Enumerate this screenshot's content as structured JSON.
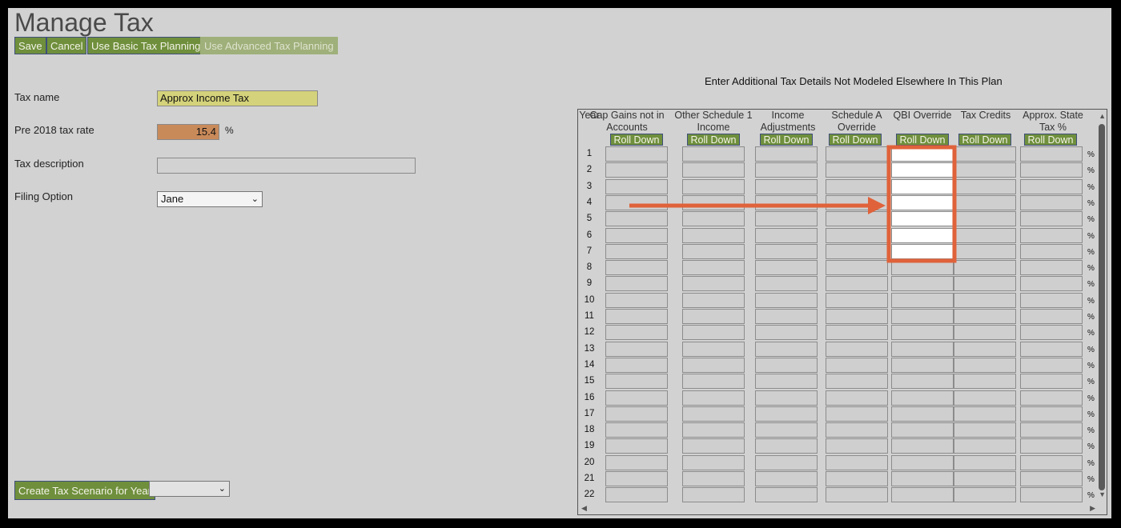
{
  "page_title": "Manage Tax",
  "toolbar": {
    "save": "Save",
    "cancel": "Cancel",
    "basic": "Use Basic Tax Planning",
    "advanced": "Use Advanced Tax Planning"
  },
  "form": {
    "tax_name_label": "Tax name",
    "tax_name_value": "Approx Income Tax",
    "rate_label": "Pre 2018 tax rate",
    "rate_value": "15.4",
    "rate_unit": "%",
    "desc_label": "Tax description",
    "desc_value": "",
    "filing_label": "Filing Option",
    "filing_value": "Jane"
  },
  "scenario": {
    "button": "Create Tax Scenario for Year",
    "year_value": ""
  },
  "grid": {
    "instruction": "Enter Additional Tax Details Not Modeled Elsewhere In This Plan",
    "year_header": "Year",
    "roll_label": "Roll Down",
    "percent": "%",
    "columns": [
      {
        "l1": "Cap Gains not in",
        "l2": "Accounts"
      },
      {
        "l1": "Other Schedule 1",
        "l2": "Income"
      },
      {
        "l1": "Income",
        "l2": "Adjustments"
      },
      {
        "l1": "Schedule A",
        "l2": "Override"
      },
      {
        "l1": "QBI Override",
        "l2": ""
      },
      {
        "l1": "Tax Credits",
        "l2": ""
      },
      {
        "l1": "Approx. State",
        "l2": "Tax %"
      }
    ],
    "rows": [
      "1",
      "2",
      "3",
      "4",
      "5",
      "6",
      "7",
      "8",
      "9",
      "10",
      "11",
      "12",
      "13",
      "14",
      "15",
      "16",
      "17",
      "18",
      "19",
      "20",
      "21",
      "22"
    ]
  },
  "colors": {
    "button_green": "#6f8f3c",
    "name_field": "#d4d27a",
    "rate_field": "#c98a5a",
    "highlight": "#e0623a"
  }
}
